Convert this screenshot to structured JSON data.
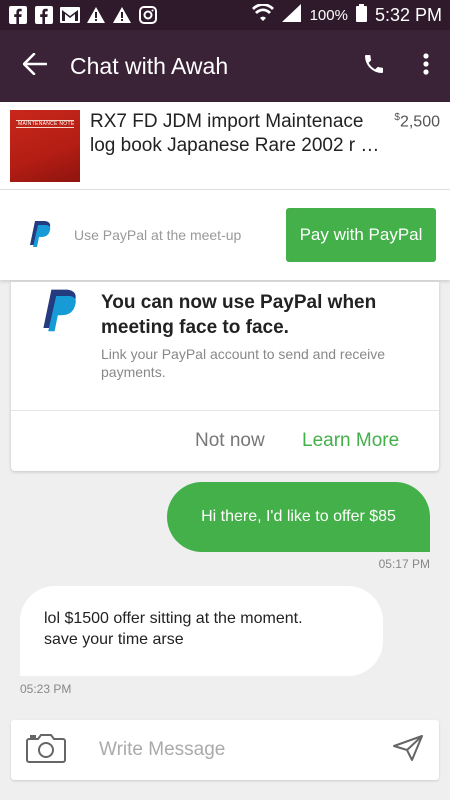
{
  "status_bar": {
    "icons": [
      "facebook-icon",
      "facebook-icon",
      "gmail-icon",
      "warning-icon",
      "warning-icon",
      "instagram-icon",
      "wifi-icon",
      "signal-icon",
      "battery-icon"
    ],
    "battery": "100%",
    "time": "5:32 PM"
  },
  "app_bar": {
    "title": "Chat with Awah",
    "icons": [
      "back-arrow-icon",
      "phone-icon",
      "more-vert-icon"
    ]
  },
  "listing": {
    "title": "RX7 FD JDM import Maintenace log book Japanese Rare 2002 r …",
    "price_currency": "$",
    "price_value": "2,500",
    "thumbnail_text": "MAINTENANCE NOTE"
  },
  "paypal_bar": {
    "hint": "Use PayPal at the meet-up",
    "button": "Pay with PayPal"
  },
  "paypal_card": {
    "title": "You can now use PayPal when meeting face to face.",
    "subtitle": "Link your PayPal account to send and receive payments.",
    "not_now": "Not now",
    "learn_more": "Learn More"
  },
  "messages": [
    {
      "direction": "outgoing",
      "text": "Hi there, I'd like to offer $85",
      "time": "05:17 PM"
    },
    {
      "direction": "incoming",
      "text": "lol $1500 offer sitting at the moment.\nsave your time arse",
      "time": "05:23 PM"
    }
  ],
  "composer": {
    "placeholder": "Write Message"
  },
  "colors": {
    "status_bar": "#2e1a2b",
    "app_bar": "#3b2337",
    "accent_green": "#43b049",
    "paypal_dark": "#253b80",
    "paypal_light": "#179bd7"
  }
}
